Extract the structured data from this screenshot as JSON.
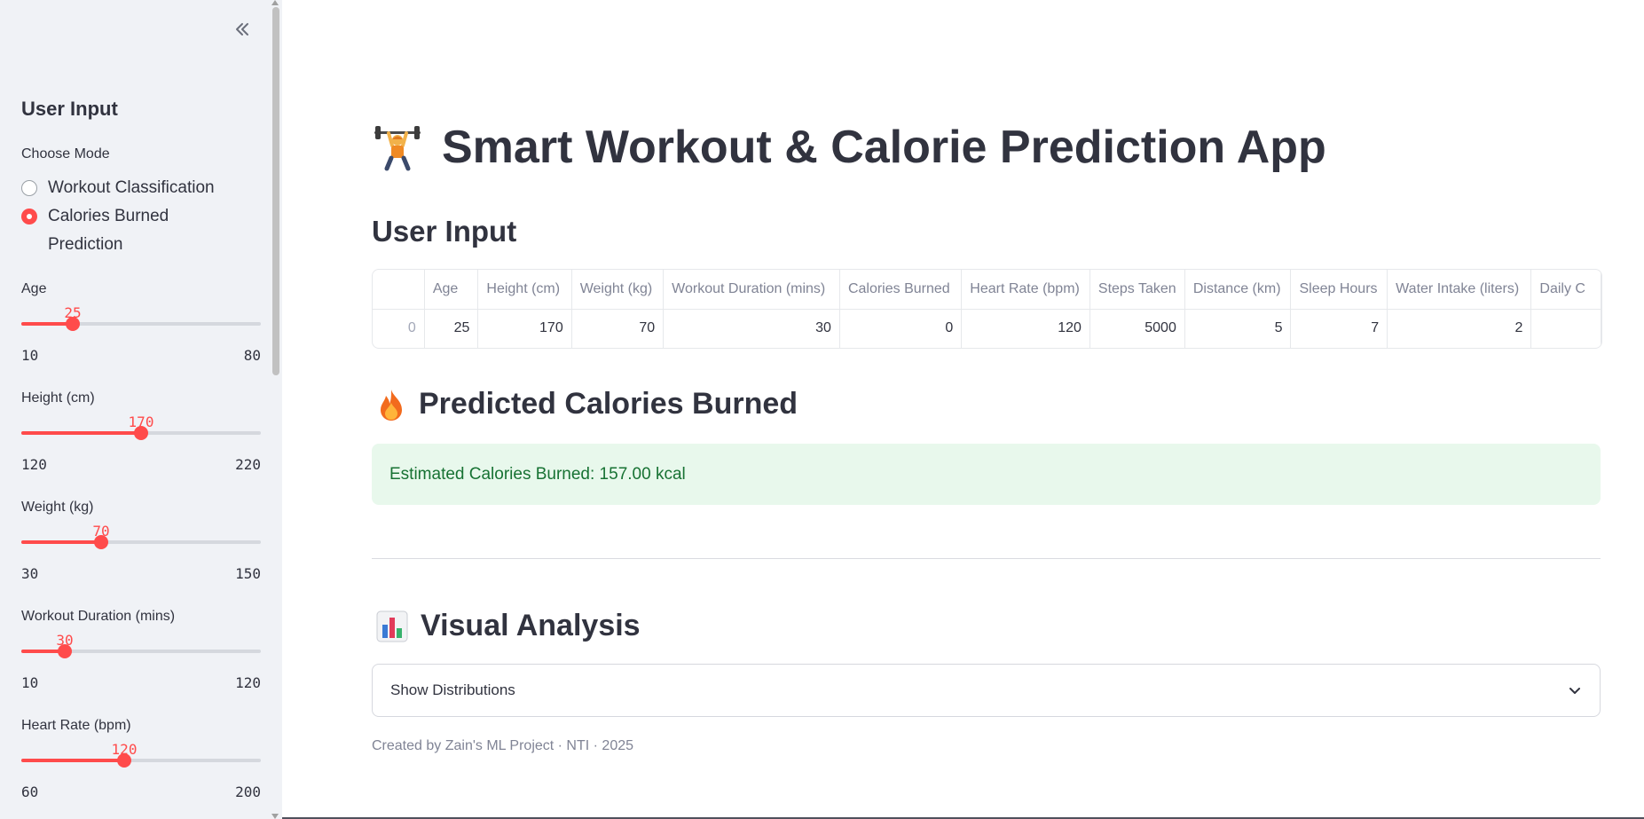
{
  "sidebar": {
    "header": "User Input",
    "mode_label": "Choose Mode",
    "modes": [
      {
        "label": "Workout Classification",
        "selected": false
      },
      {
        "label": "Calories Burned Prediction",
        "selected": true
      }
    ],
    "sliders": [
      {
        "label": "Age",
        "value": 25,
        "min": 10,
        "max": 80
      },
      {
        "label": "Height (cm)",
        "value": 170,
        "min": 120,
        "max": 220
      },
      {
        "label": "Weight (kg)",
        "value": 70,
        "min": 30,
        "max": 150
      },
      {
        "label": "Workout Duration (mins)",
        "value": 30,
        "min": 10,
        "max": 120
      },
      {
        "label": "Heart Rate (bpm)",
        "value": 120,
        "min": 60,
        "max": 200
      }
    ]
  },
  "main": {
    "title": "Smart Workout & Calorie Prediction App",
    "user_input_heading": "User Input",
    "table": {
      "columns": [
        "",
        "Age",
        "Height (cm)",
        "Weight (kg)",
        "Workout Duration (mins)",
        "Calories Burned",
        "Heart Rate (bpm)",
        "Steps Taken",
        "Distance (km)",
        "Sleep Hours",
        "Water Intake (liters)",
        "Daily C"
      ],
      "rows": [
        [
          "0",
          "25",
          "170",
          "70",
          "30",
          "0",
          "120",
          "5000",
          "5",
          "7",
          "2",
          ""
        ]
      ]
    },
    "prediction_heading": "Predicted Calories Burned",
    "prediction_text": "Estimated Calories Burned: 157.00 kcal",
    "visual_heading": "Visual Analysis",
    "expander_label": "Show Distributions",
    "footer": "Created by Zain's ML Project · NTI · 2025"
  },
  "icons": {
    "collapse": "double-chevron-left-icon",
    "title_emoji": "weightlifter-icon",
    "prediction_emoji": "fire-icon",
    "visual_emoji": "bar-chart-icon",
    "expander": "chevron-down-icon"
  },
  "colors": {
    "accent": "#ff4b4b",
    "sidebar_bg": "#f0f2f6",
    "success_bg": "#e8f8ec",
    "success_text": "#177233",
    "text": "#31333f"
  }
}
